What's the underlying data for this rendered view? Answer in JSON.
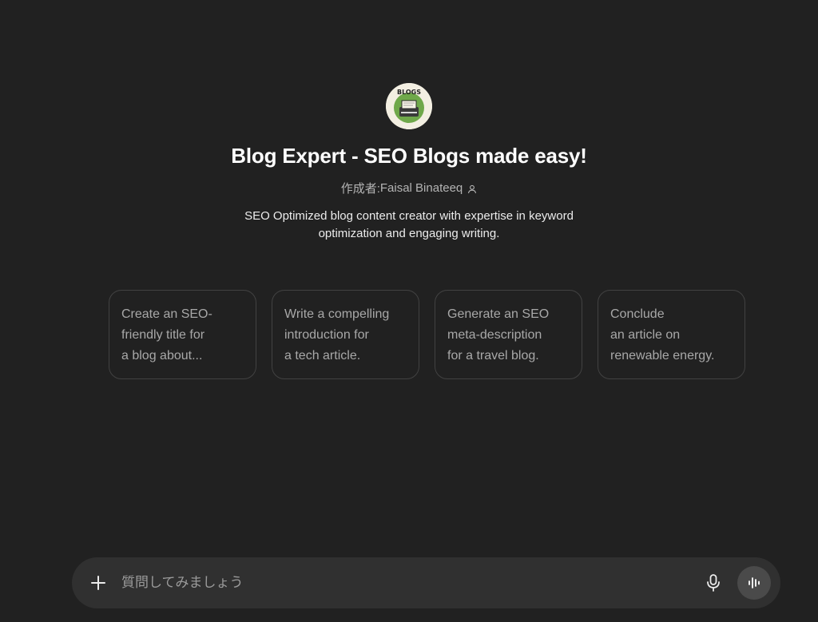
{
  "gpt": {
    "logo_text": "BLOGS",
    "title": "Blog Expert - SEO Blogs made easy!",
    "author_prefix": "作成者: ",
    "author_name": "Faisal Binateeq",
    "description": "SEO Optimized blog content creator with expertise in keyword optimization and engaging writing."
  },
  "starters": [
    {
      "label": "Create an SEO-\nfriendly title for\na blog about..."
    },
    {
      "label": "Write a compelling\nintroduction for\na tech article."
    },
    {
      "label": "Generate an SEO\nmeta-description\nfor a travel blog."
    },
    {
      "label": "Conclude\nan article on\nrenewable energy."
    }
  ],
  "composer": {
    "placeholder": "質問してみましょう",
    "plus_icon": "plus-icon",
    "mic_icon": "microphone-icon",
    "voice_icon": "voice-waveform-icon"
  },
  "colors": {
    "background": "#212121",
    "card_border": "#424242",
    "composer_bg": "#303030"
  }
}
